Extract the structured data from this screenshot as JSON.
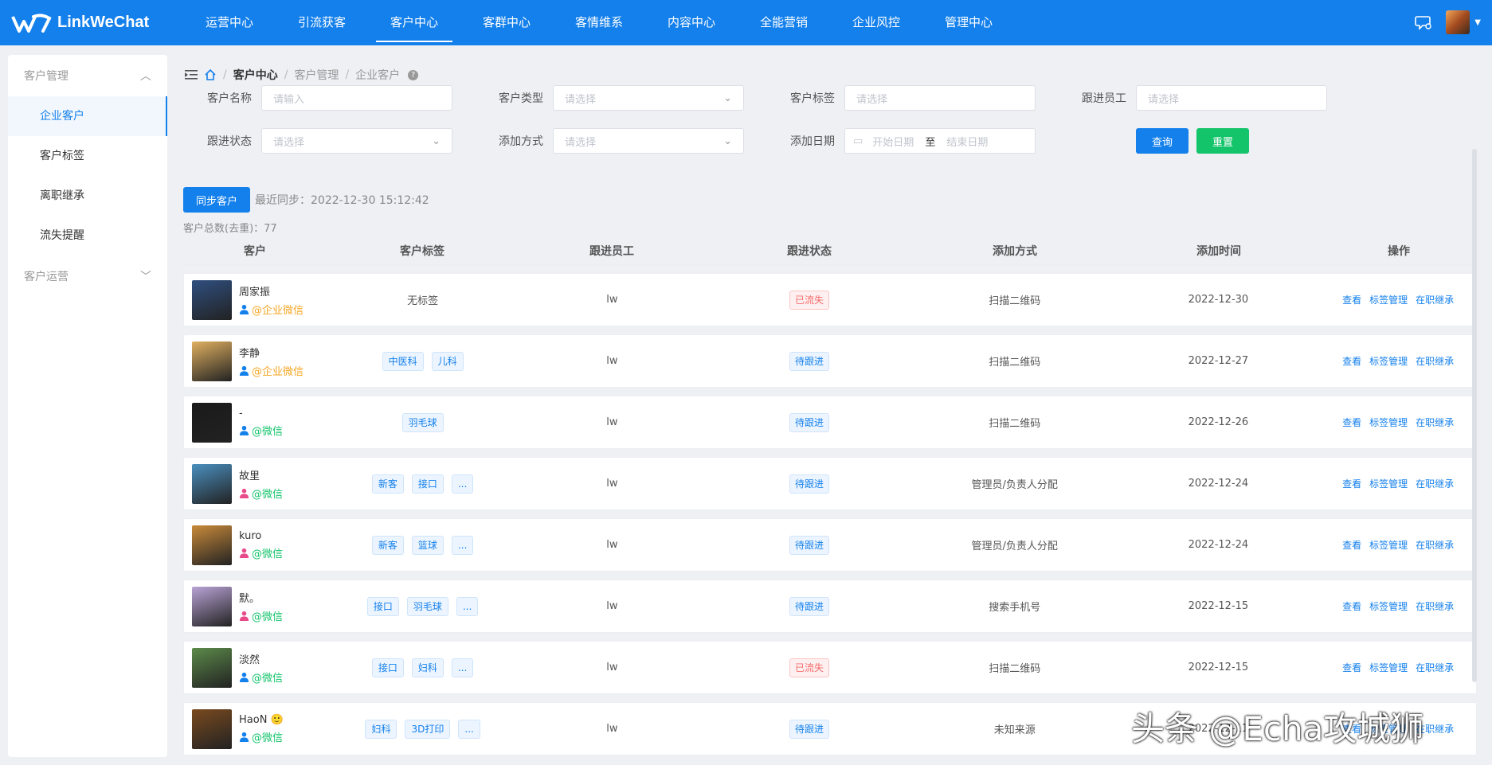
{
  "app": {
    "name": "LinkWeChat"
  },
  "nav": [
    "运营中心",
    "引流获客",
    "客户中心",
    "客群中心",
    "客情维系",
    "内容中心",
    "全能营销",
    "企业风控",
    "管理中心"
  ],
  "nav_active": 2,
  "sidebar": {
    "group1": "客户管理",
    "items": [
      "企业客户",
      "客户标签",
      "离职继承",
      "流失提醒"
    ],
    "group2": "客户运营"
  },
  "breadcrumb": [
    "客户中心",
    "客户管理",
    "企业客户"
  ],
  "filters": {
    "customer_name": {
      "label": "客户名称",
      "placeholder": "请输入"
    },
    "customer_type": {
      "label": "客户类型",
      "placeholder": "请选择"
    },
    "customer_tag": {
      "label": "客户标签",
      "placeholder": "请选择"
    },
    "employee": {
      "label": "跟进员工",
      "placeholder": "请选择"
    },
    "follow_status": {
      "label": "跟进状态",
      "placeholder": "请选择"
    },
    "add_way": {
      "label": "添加方式",
      "placeholder": "请选择"
    },
    "add_date": {
      "label": "添加日期",
      "start": "开始日期",
      "to": "至",
      "end": "结束日期"
    },
    "search_btn": "查询",
    "reset_btn": "重置"
  },
  "sync": {
    "button": "同步客户",
    "last_sync": "最近同步：2022-12-30 15:12:42"
  },
  "total": "客户总数(去重)：77",
  "columns": [
    "客户",
    "客户标签",
    "跟进员工",
    "跟进状态",
    "添加方式",
    "添加时间",
    "操作"
  ],
  "ops": [
    "查看",
    "标签管理",
    "在职继承"
  ],
  "rows": [
    {
      "name": "周家振",
      "source": "@企业微信",
      "source_type": "wecom",
      "tags": [],
      "no_tag": "无标签",
      "employee": "lw",
      "status": "已流失",
      "status_type": "lost",
      "way": "扫描二维码",
      "time": "2022-12-30",
      "avatar": "#2f4f7f",
      "gender": "male"
    },
    {
      "name": "李静",
      "source": "@企业微信",
      "source_type": "wecom",
      "tags": [
        "中医科",
        "儿科"
      ],
      "employee": "lw",
      "status": "待跟进",
      "status_type": "pending",
      "way": "扫描二维码",
      "time": "2022-12-27",
      "avatar": "#e0b060",
      "gender": "male"
    },
    {
      "name": "-",
      "source": "@微信",
      "source_type": "wechat",
      "tags": [
        "羽毛球"
      ],
      "employee": "lw",
      "status": "待跟进",
      "status_type": "pending",
      "way": "扫描二维码",
      "time": "2022-12-26",
      "avatar": "#1a1a1a",
      "gender": "male"
    },
    {
      "name": "故里",
      "source": "@微信",
      "source_type": "wechat",
      "tags": [
        "新客",
        "接口",
        "..."
      ],
      "employee": "lw",
      "status": "待跟进",
      "status_type": "pending",
      "way": "管理员/负责人分配",
      "time": "2022-12-24",
      "avatar": "#4a8fbf",
      "gender": "female"
    },
    {
      "name": "kuro",
      "source": "@微信",
      "source_type": "wechat",
      "tags": [
        "新客",
        "篮球",
        "..."
      ],
      "employee": "lw",
      "status": "待跟进",
      "status_type": "pending",
      "way": "管理员/负责人分配",
      "time": "2022-12-24",
      "avatar": "#c98a3a",
      "gender": "female"
    },
    {
      "name": "默。",
      "source": "@微信",
      "source_type": "wechat",
      "tags": [
        "接口",
        "羽毛球",
        "..."
      ],
      "employee": "lw",
      "status": "待跟进",
      "status_type": "pending",
      "way": "搜索手机号",
      "time": "2022-12-15",
      "avatar": "#b9a3d6",
      "gender": "female"
    },
    {
      "name": "淡然",
      "source": "@微信",
      "source_type": "wechat",
      "tags": [
        "接口",
        "妇科",
        "..."
      ],
      "employee": "lw",
      "status": "已流失",
      "status_type": "lost",
      "way": "扫描二维码",
      "time": "2022-12-15",
      "avatar": "#5c8a4a",
      "gender": "male"
    },
    {
      "name": "HaoN 🙂",
      "source": "@微信",
      "source_type": "wechat",
      "tags": [
        "妇科",
        "3D打印",
        "..."
      ],
      "employee": "lw",
      "status": "待跟进",
      "status_type": "pending",
      "way": "未知来源",
      "time": "2022-12-11",
      "avatar": "#7a4a1f",
      "gender": "male"
    }
  ],
  "watermark": "头条 @Echa攻城狮",
  "colors": {
    "primary": "#1480ec",
    "success": "#14c46b",
    "danger": "#f56c6c",
    "wecom": "#f5a623"
  }
}
